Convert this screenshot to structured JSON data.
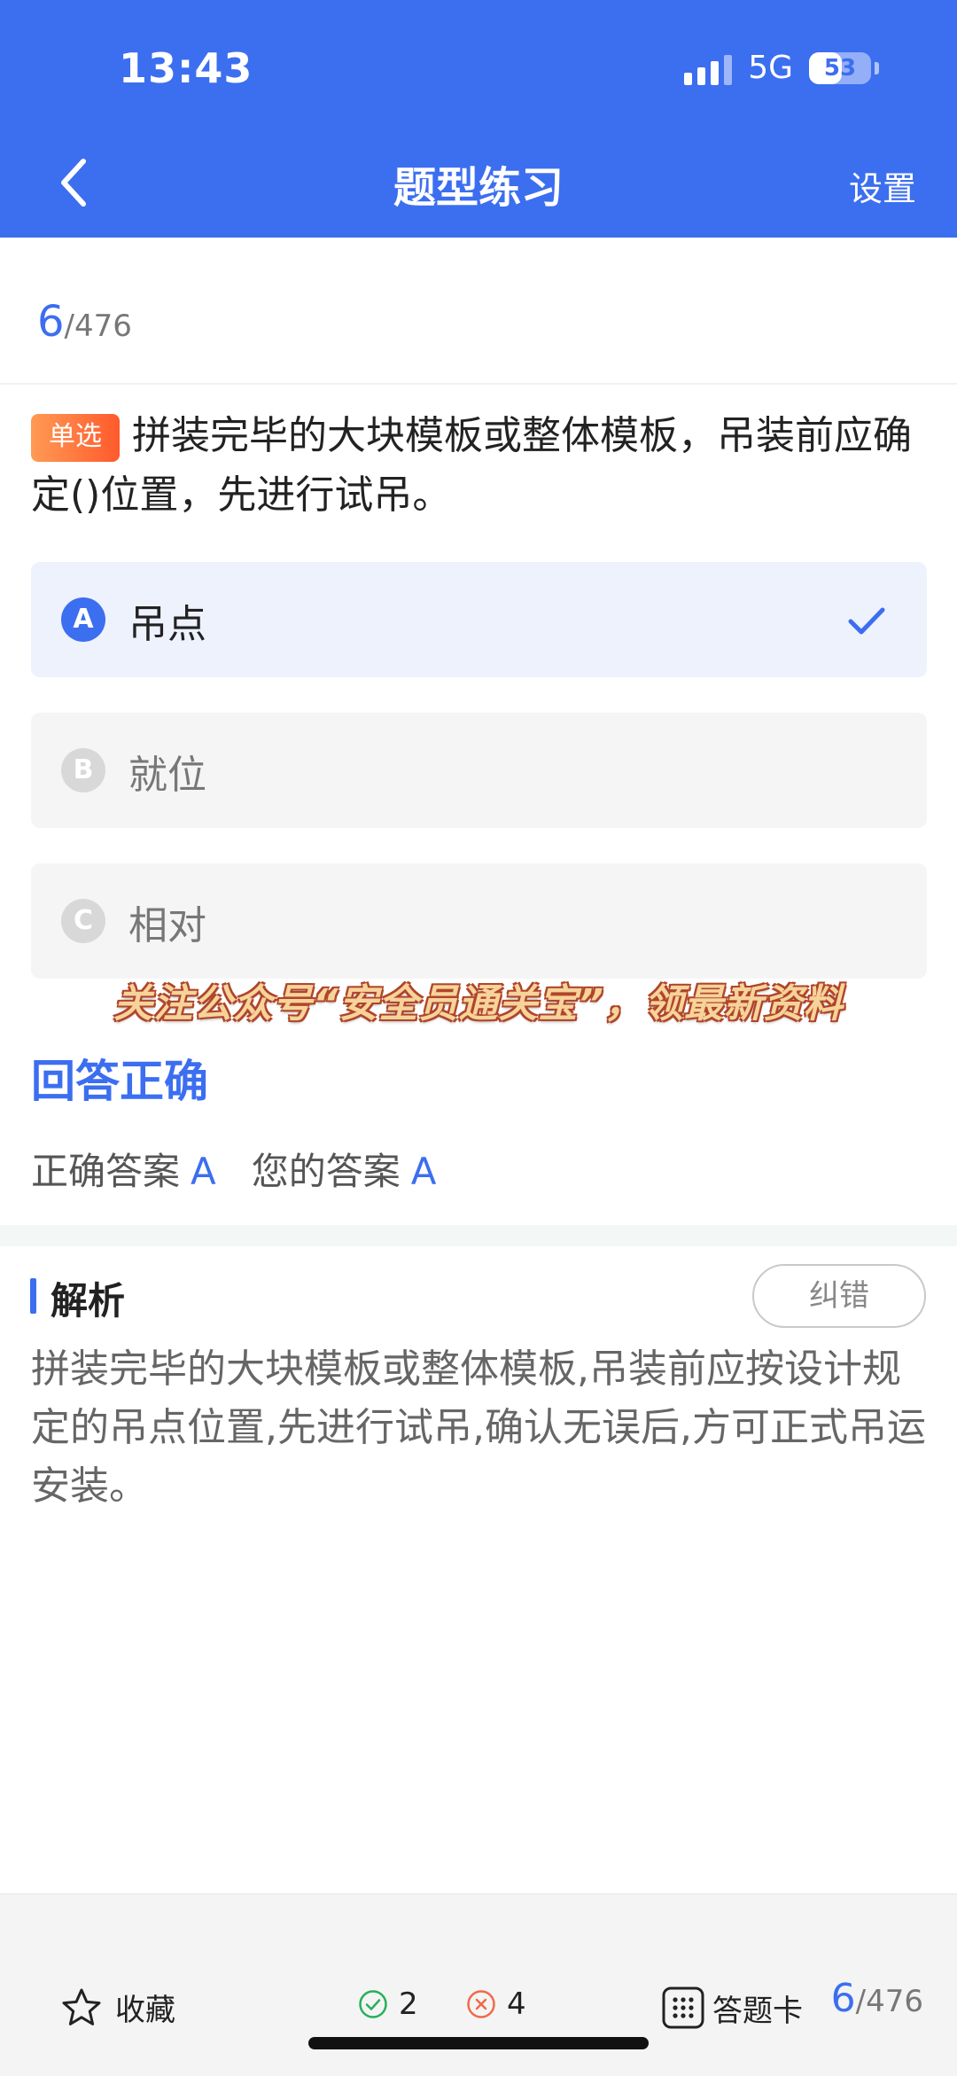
{
  "status": {
    "time": "13:43",
    "network": "5G",
    "battery": "53",
    "battery_level": 0.53
  },
  "nav": {
    "title": "题型练习",
    "settings": "设置"
  },
  "progress": {
    "current": "6",
    "total": "/476"
  },
  "question": {
    "tag": "单选",
    "text": "拼装完毕的大块模板或整体模板，吊装前应确定()位置，先进行试吊。"
  },
  "options": [
    {
      "letter": "A",
      "text": "吊点",
      "selected": true
    },
    {
      "letter": "B",
      "text": "就位",
      "selected": false
    },
    {
      "letter": "C",
      "text": "相对",
      "selected": false
    }
  ],
  "watermark": "关注公众号“安全员通关宝”，领最新资料",
  "result": {
    "title": "回答正确",
    "correct_label": "正确答案",
    "correct_value": "A",
    "yours_label": "您的答案",
    "yours_value": "A"
  },
  "analysis": {
    "title": "解析",
    "report_button": "纠错",
    "text": "拼装完毕的大块模板或整体模板,吊装前应按设计规定的吊点位置,先进行试吊,确认无误后,方可正式吊运安装。"
  },
  "bottom": {
    "favorite": "收藏",
    "right_count": "2",
    "wrong_count": "4",
    "answer_card": "答题卡",
    "current": "6",
    "total": "/476"
  },
  "colors": {
    "primary": "#3c6ef0",
    "tag": "#ff6a35",
    "right": "#27b05a",
    "wrong": "#f06a4a"
  }
}
